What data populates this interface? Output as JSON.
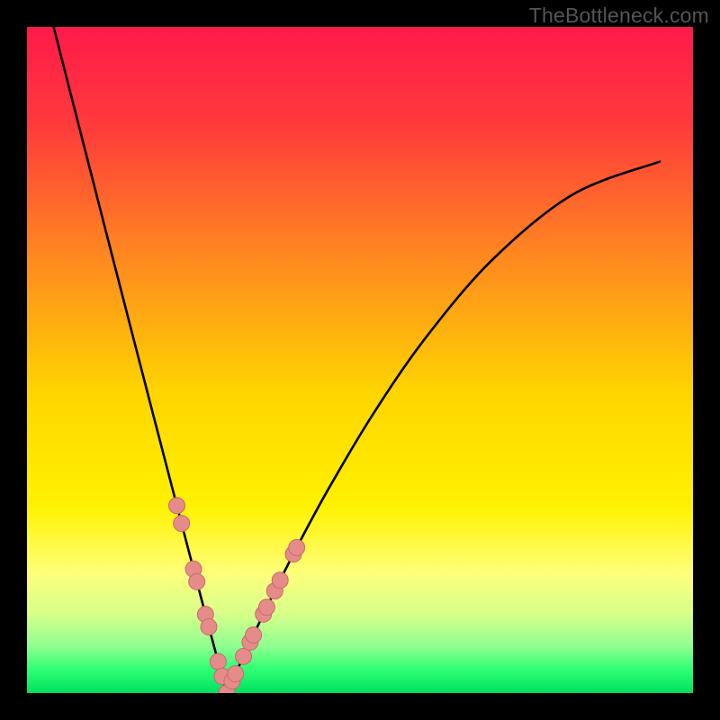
{
  "watermark": {
    "text": "TheBottleneck.com"
  },
  "gradient": {
    "stops": [
      {
        "offset": 0.0,
        "color": "#ff1a4b"
      },
      {
        "offset": 0.15,
        "color": "#ff3b3b"
      },
      {
        "offset": 0.35,
        "color": "#ff8a1f"
      },
      {
        "offset": 0.55,
        "color": "#ffd500"
      },
      {
        "offset": 0.72,
        "color": "#fff200"
      },
      {
        "offset": 0.82,
        "color": "#fdff7a"
      },
      {
        "offset": 0.88,
        "color": "#d8ff8a"
      },
      {
        "offset": 0.93,
        "color": "#8fff8f"
      },
      {
        "offset": 0.965,
        "color": "#2dff74"
      },
      {
        "offset": 1.0,
        "color": "#00e060"
      }
    ]
  },
  "curve": {
    "stroke": "#000000",
    "width": 2.6,
    "trough_x": 0.3,
    "left_sample_x": [
      0.04,
      0.07,
      0.1,
      0.13,
      0.16,
      0.19,
      0.22,
      0.25,
      0.27,
      0.285,
      0.295
    ],
    "right_sample_x": [
      0.305,
      0.315,
      0.33,
      0.36,
      0.4,
      0.45,
      0.52,
      0.6,
      0.7,
      0.82,
      0.95
    ],
    "markers": {
      "fill": "#e58b8a",
      "stroke": "#c96a69",
      "radius": 9,
      "left_x": [
        0.225,
        0.232,
        0.25,
        0.255,
        0.268,
        0.273,
        0.287,
        0.293,
        0.3
      ],
      "right_x": [
        0.308,
        0.313,
        0.325,
        0.335,
        0.34,
        0.355,
        0.36,
        0.372,
        0.38,
        0.4,
        0.405
      ]
    }
  },
  "chart_data": {
    "type": "line",
    "title": "",
    "xlabel": "",
    "ylabel": "",
    "xlim": [
      0,
      1
    ],
    "ylim": [
      0,
      1
    ],
    "notes": "V-shaped bottleneck curve; background hue maps vertical position from red (top, y≈1) through orange/yellow to green (bottom, y≈0). Curve minimum near x≈0.30 at y≈0; left branch rises to y≈1 at x≈0.04; right branch rises to y≈0.78 at x≈0.95. Salmon markers cluster near the trough on both branches between roughly y≈0.04 and y≈0.30.",
    "series": [
      {
        "name": "left-branch",
        "x": [
          0.04,
          0.07,
          0.1,
          0.13,
          0.16,
          0.19,
          0.22,
          0.25,
          0.27,
          0.285,
          0.295,
          0.3
        ],
        "y": [
          1.0,
          0.87,
          0.75,
          0.635,
          0.52,
          0.405,
          0.295,
          0.175,
          0.095,
          0.04,
          0.01,
          0.0
        ]
      },
      {
        "name": "right-branch",
        "x": [
          0.3,
          0.305,
          0.315,
          0.33,
          0.36,
          0.4,
          0.45,
          0.52,
          0.6,
          0.7,
          0.82,
          0.95
        ],
        "y": [
          0.0,
          0.005,
          0.02,
          0.05,
          0.12,
          0.21,
          0.32,
          0.44,
          0.55,
          0.65,
          0.73,
          0.78
        ]
      }
    ],
    "markers": [
      {
        "branch": "left",
        "x": 0.225,
        "y": 0.275
      },
      {
        "branch": "left",
        "x": 0.232,
        "y": 0.245
      },
      {
        "branch": "left",
        "x": 0.25,
        "y": 0.175
      },
      {
        "branch": "left",
        "x": 0.255,
        "y": 0.155
      },
      {
        "branch": "left",
        "x": 0.268,
        "y": 0.105
      },
      {
        "branch": "left",
        "x": 0.273,
        "y": 0.085
      },
      {
        "branch": "left",
        "x": 0.287,
        "y": 0.035
      },
      {
        "branch": "left",
        "x": 0.293,
        "y": 0.015
      },
      {
        "branch": "left",
        "x": 0.3,
        "y": 0.0
      },
      {
        "branch": "right",
        "x": 0.308,
        "y": 0.01
      },
      {
        "branch": "right",
        "x": 0.313,
        "y": 0.015
      },
      {
        "branch": "right",
        "x": 0.325,
        "y": 0.04
      },
      {
        "branch": "right",
        "x": 0.335,
        "y": 0.06
      },
      {
        "branch": "right",
        "x": 0.34,
        "y": 0.075
      },
      {
        "branch": "right",
        "x": 0.355,
        "y": 0.11
      },
      {
        "branch": "right",
        "x": 0.36,
        "y": 0.12
      },
      {
        "branch": "right",
        "x": 0.372,
        "y": 0.145
      },
      {
        "branch": "right",
        "x": 0.38,
        "y": 0.165
      },
      {
        "branch": "right",
        "x": 0.4,
        "y": 0.21
      },
      {
        "branch": "right",
        "x": 0.405,
        "y": 0.22
      }
    ]
  }
}
